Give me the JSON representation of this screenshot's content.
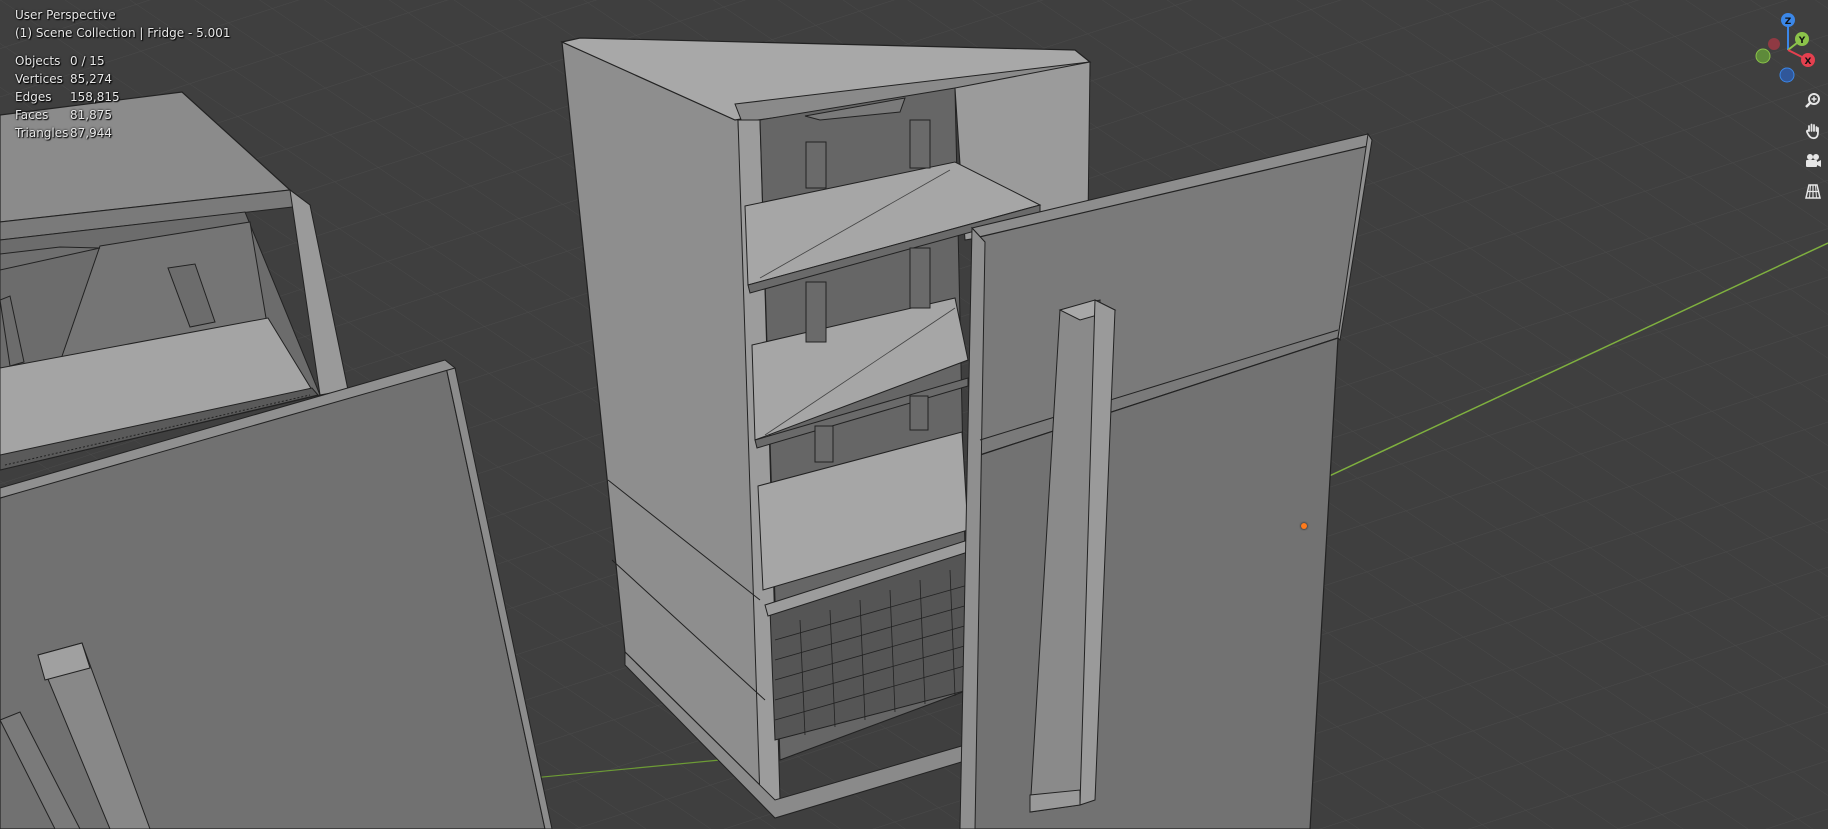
{
  "viewport": {
    "perspective_label": "User Perspective",
    "collection_label": "(1) Scene Collection | Fridge - 5.001"
  },
  "stats": [
    {
      "label": "Objects",
      "value": "0 / 15"
    },
    {
      "label": "Vertices",
      "value": "85,274"
    },
    {
      "label": "Edges",
      "value": "158,815"
    },
    {
      "label": "Faces",
      "value": "81,875"
    },
    {
      "label": "Triangles",
      "value": "87,944"
    }
  ],
  "gizmo": {
    "z_label": "Z",
    "y_label": "Y",
    "x_label": "X",
    "colors": {
      "x": "#e5404f",
      "y": "#8bc34a",
      "z": "#3b87e8",
      "neg_x": "#8f3a43",
      "neg_y": "#5e8a3a",
      "neg_z": "#30579a"
    }
  },
  "navigation": [
    {
      "name": "zoom-icon"
    },
    {
      "name": "hand-pan-icon"
    },
    {
      "name": "camera-icon"
    },
    {
      "name": "ortho-grid-icon"
    }
  ],
  "colors": {
    "background": "#3f3f3f",
    "grid": "#4a4a4a",
    "y_axis": "#8bc34a",
    "object_origin": "#ff7b1c"
  }
}
